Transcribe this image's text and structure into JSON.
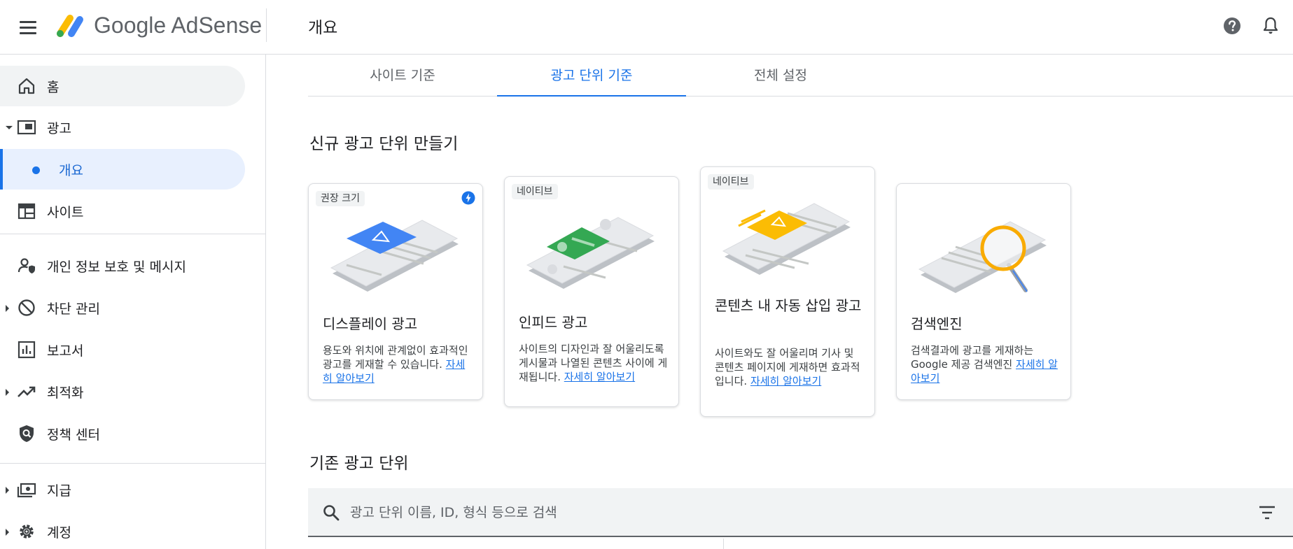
{
  "header": {
    "brand": "Google AdSense",
    "page_title": "개요"
  },
  "sidebar": {
    "items": [
      {
        "label": "홈",
        "icon": "home-icon"
      },
      {
        "label": "광고",
        "icon": "ads-icon"
      },
      {
        "label": "개요",
        "icon": "dot"
      },
      {
        "label": "사이트",
        "icon": "sites-icon"
      },
      {
        "label": "개인 정보 보호 및 메시지",
        "icon": "privacy-icon"
      },
      {
        "label": "차단 관리",
        "icon": "block-icon"
      },
      {
        "label": "보고서",
        "icon": "reports-icon"
      },
      {
        "label": "최적화",
        "icon": "trending-icon"
      },
      {
        "label": "정책 센터",
        "icon": "policy-icon"
      },
      {
        "label": "지급",
        "icon": "payments-icon"
      },
      {
        "label": "계정",
        "icon": "settings-icon"
      }
    ]
  },
  "tabs": [
    {
      "label": "사이트 기준",
      "active": false
    },
    {
      "label": "광고 단위 기준",
      "active": true
    },
    {
      "label": "전체 설정",
      "active": false
    }
  ],
  "sections": {
    "new_title": "신규 광고 단위 만들기",
    "existing_title": "기존 광고 단위"
  },
  "cards": [
    {
      "chip": "권장 크기",
      "title": "디스플레이 광고",
      "desc": "용도와 위치에 관계없이 효과적인 광고를 게재할 수 있습니다. ",
      "link": "자세히 알아보기"
    },
    {
      "chip": "네이티브",
      "title": "인피드 광고",
      "desc": "사이트의 디자인과 잘 어울리도록 게시물과 나열된 콘텐츠 사이에 게재됩니다. ",
      "link": "자세히 알아보기"
    },
    {
      "chip": "네이티브",
      "title": "콘텐츠 내 자동 삽입 광고",
      "desc": "사이트와도 잘 어울리며 기사 및 콘텐츠 페이지에 게재하면 효과적입니다. ",
      "link": "자세히 알아보기"
    },
    {
      "chip": "",
      "title": "검색엔진",
      "desc": "검색결과에 광고를 게재하는 Google 제공 검색엔진 ",
      "link": "자세히 알아보기"
    }
  ],
  "search": {
    "placeholder": "광고 단위 이름, ID, 형식 등으로 검색",
    "value": ""
  },
  "colors": {
    "accent": "#1a73e8",
    "display_blue": "#4285f4",
    "infeed_green": "#34a853",
    "inarticle_yellow": "#fbbc04",
    "search_gold": "#f9ab00"
  }
}
